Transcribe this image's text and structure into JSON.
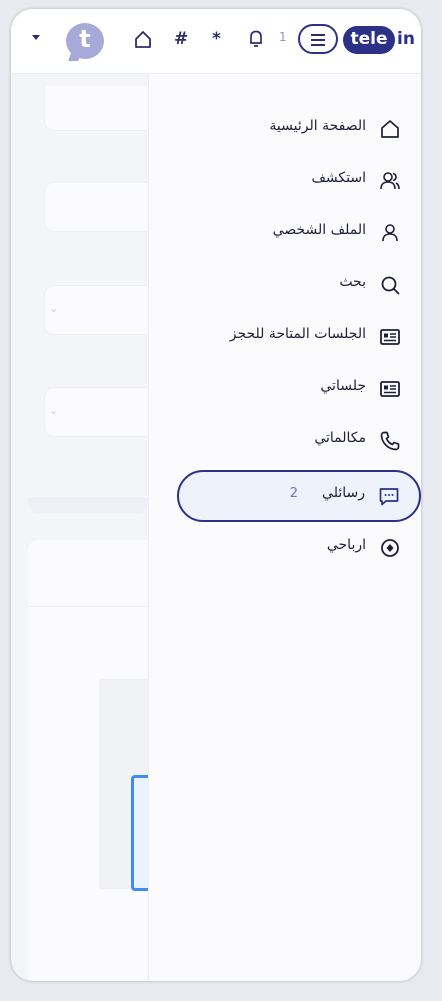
{
  "topbar": {
    "avatar_letter": "t",
    "notification_count": "1",
    "logo_word": "tele",
    "logo_suffix": "in",
    "icons": [
      "caret-down-icon",
      "home-icon",
      "hash-icon",
      "asterisk-icon",
      "bell-icon",
      "menu-icon"
    ]
  },
  "drawer": {
    "items": [
      {
        "label": "الصفحة الرئيسية",
        "icon": "home-icon"
      },
      {
        "label": "استكشف",
        "icon": "users-icon"
      },
      {
        "label": "الملف الشخصي",
        "icon": "user-icon"
      },
      {
        "label": "بحث",
        "icon": "search-icon"
      },
      {
        "label": "الجلسات المتاحة للحجز",
        "icon": "presentation-icon"
      },
      {
        "label": "جلساتي",
        "icon": "presentation-icon"
      },
      {
        "label": "مكالماتي",
        "icon": "phone-icon"
      },
      {
        "label": "رسائلي",
        "icon": "message-icon",
        "count": "2",
        "active": true
      },
      {
        "label": "ارباحي",
        "icon": "coin-icon"
      }
    ]
  },
  "colors": {
    "brand": "#2b3186",
    "avatar": "#a7a9d9",
    "badge": "#6f74c0",
    "active_bg": "#eef2fb"
  }
}
